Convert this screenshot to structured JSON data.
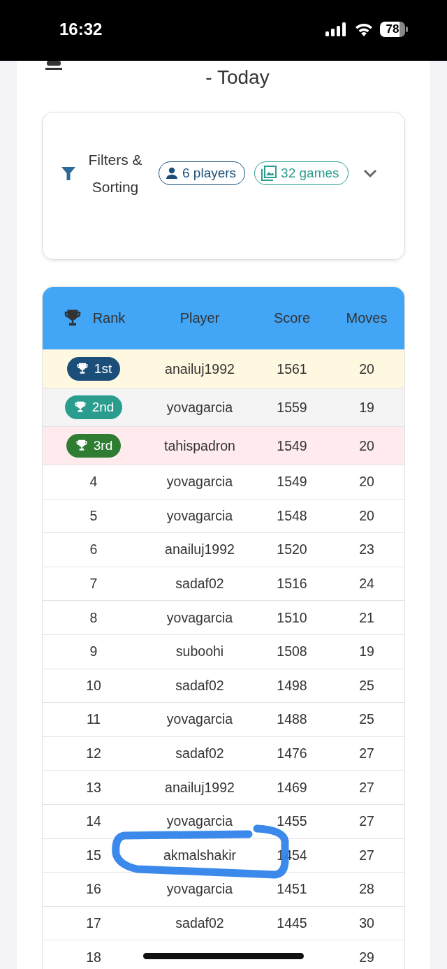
{
  "status_bar": {
    "time": "16:32",
    "battery": "78"
  },
  "header": {
    "title": "- Today"
  },
  "filters": {
    "label": "Filters & Sorting",
    "expanded": false,
    "chips": [
      {
        "kind": "players",
        "label": "6 players"
      },
      {
        "kind": "games",
        "label": "32 games"
      }
    ]
  },
  "table": {
    "columns": [
      "Rank",
      "Player",
      "Score",
      "Moves"
    ],
    "rows": [
      {
        "kind": "first",
        "rank": "1st",
        "player": "anailuj1992",
        "score": "1561",
        "moves": "20",
        "circled": false
      },
      {
        "kind": "second",
        "rank": "2nd",
        "player": "yovagarcia",
        "score": "1559",
        "moves": "19",
        "circled": false
      },
      {
        "kind": "third",
        "rank": "3rd",
        "player": "tahispadron",
        "score": "1549",
        "moves": "20",
        "circled": false
      },
      {
        "kind": "plain",
        "rank": "4",
        "player": "yovagarcia",
        "score": "1549",
        "moves": "20",
        "circled": false
      },
      {
        "kind": "plain",
        "rank": "5",
        "player": "yovagarcia",
        "score": "1548",
        "moves": "20",
        "circled": false
      },
      {
        "kind": "plain",
        "rank": "6",
        "player": "anailuj1992",
        "score": "1520",
        "moves": "23",
        "circled": false
      },
      {
        "kind": "plain",
        "rank": "7",
        "player": "sadaf02",
        "score": "1516",
        "moves": "24",
        "circled": false
      },
      {
        "kind": "plain",
        "rank": "8",
        "player": "yovagarcia",
        "score": "1510",
        "moves": "21",
        "circled": false
      },
      {
        "kind": "plain",
        "rank": "9",
        "player": "suboohi",
        "score": "1508",
        "moves": "19",
        "circled": false
      },
      {
        "kind": "plain",
        "rank": "10",
        "player": "sadaf02",
        "score": "1498",
        "moves": "25",
        "circled": false
      },
      {
        "kind": "plain",
        "rank": "11",
        "player": "yovagarcia",
        "score": "1488",
        "moves": "25",
        "circled": false
      },
      {
        "kind": "plain",
        "rank": "12",
        "player": "sadaf02",
        "score": "1476",
        "moves": "27",
        "circled": false
      },
      {
        "kind": "plain",
        "rank": "13",
        "player": "anailuj1992",
        "score": "1469",
        "moves": "27",
        "circled": false
      },
      {
        "kind": "plain",
        "rank": "14",
        "player": "yovagarcia",
        "score": "1455",
        "moves": "27",
        "circled": false
      },
      {
        "kind": "plain",
        "rank": "15",
        "player": "akmalshakir",
        "score": "1454",
        "moves": "27",
        "circled": true
      },
      {
        "kind": "plain",
        "rank": "16",
        "player": "yovagarcia",
        "score": "1451",
        "moves": "28",
        "circled": false
      },
      {
        "kind": "plain",
        "rank": "17",
        "player": "sadaf02",
        "score": "1445",
        "moves": "30",
        "circled": false
      },
      {
        "kind": "plain",
        "rank": "18",
        "moves": "29",
        "circled": false
      }
    ]
  }
}
